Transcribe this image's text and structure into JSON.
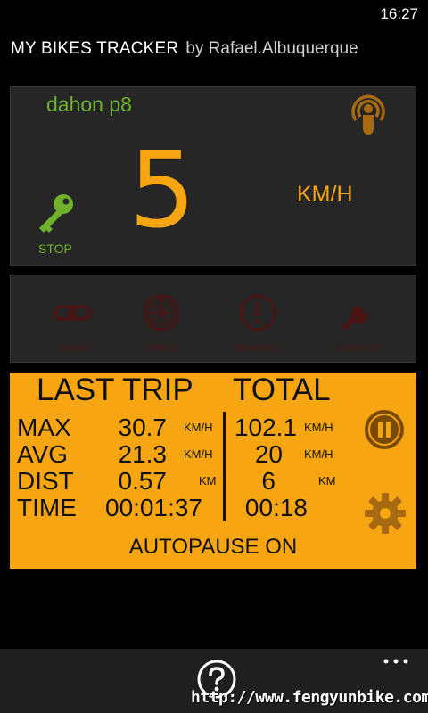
{
  "status_bar": {
    "time": "16:27"
  },
  "app": {
    "title": "MY BIKES TRACKER",
    "author": "by Rafael.Albuquerque"
  },
  "speed_panel": {
    "bike_name": "dahon p8",
    "speed": "5",
    "unit": "KM/H",
    "stop_label": "STOP",
    "icons": {
      "gps": "gps-tracking-icon",
      "key": "key-icon"
    }
  },
  "nav_buttons": [
    {
      "label": "CHAIN",
      "icon": "chain-icon"
    },
    {
      "label": "TIRES",
      "icon": "wheel-icon"
    },
    {
      "label": "BRAKES",
      "icon": "warning-icon"
    },
    {
      "label": "SERVICE",
      "icon": "wrench-icon"
    }
  ],
  "stats": {
    "headers": {
      "last_trip": "LAST TRIP",
      "total": "TOTAL"
    },
    "rows": [
      {
        "label": "MAX",
        "trip": "30.7",
        "trip_unit": "KM/H",
        "total": "102.1",
        "total_unit": "KM/H"
      },
      {
        "label": "AVG",
        "trip": "21.3",
        "trip_unit": "KM/H",
        "total": "20",
        "total_unit": "KM/H"
      },
      {
        "label": "DIST",
        "trip": "0.57",
        "trip_unit": "KM",
        "total": "6",
        "total_unit": "KM"
      },
      {
        "label": "TIME",
        "trip": "00:01:37",
        "trip_unit": "",
        "total": "00:18",
        "total_unit": ""
      }
    ],
    "autopause": "AUTOPAUSE ON",
    "icons": {
      "pause": "pause-icon",
      "settings": "gear-icon"
    }
  },
  "app_bar": {
    "help_icon": "help-icon",
    "more_icon": "more-icon",
    "watermark": "http://www.fengyunbike.com"
  },
  "colors": {
    "accent": "#f7a511",
    "green": "#6fb22a",
    "panel": "#262626",
    "disabled_red": "#4a1515"
  }
}
